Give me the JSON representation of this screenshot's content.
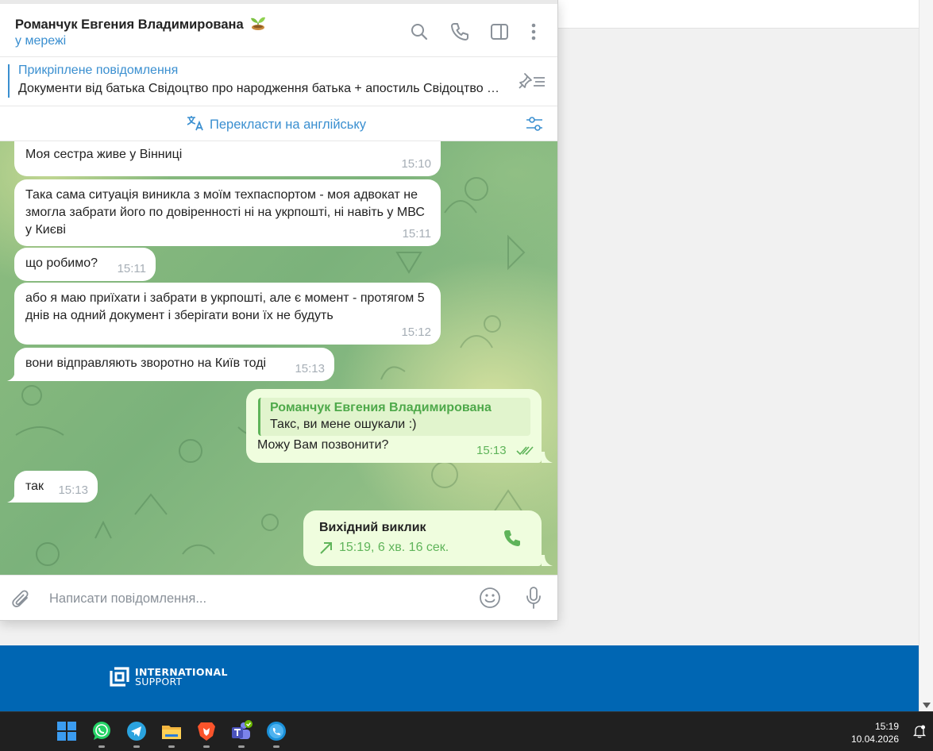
{
  "chat": {
    "title": "Романчук Евгения Владимирована",
    "status": "у мережі"
  },
  "pinned": {
    "title": "Прикріплене повідомлення",
    "text": "Документи від батька   Свідоцтво про народження батька + апостиль Свідоцтво про народження"
  },
  "translate": {
    "label": "Перекласти на англійську"
  },
  "messages": [
    {
      "text": "Моя сестра живе у Вінниці",
      "time": "15:10",
      "direction": "in"
    },
    {
      "text": "Така сама ситуація виникла з моїм техпаспортом - моя адвокат не змогла забрати його по довіренності ні на укрпошті, ні навіть у МВС у Києві",
      "time": "15:11",
      "direction": "in"
    },
    {
      "text": "що робимо?",
      "time": "15:11",
      "direction": "in"
    },
    {
      "text": "або я маю приїхати і забрати в укрпошті, але є момент - протягом 5 днів на одний документ і зберігати вони їх не будуть",
      "time": "15:12",
      "direction": "in"
    },
    {
      "text": "вони відправляють зворотно на Київ тоді",
      "time": "15:13",
      "direction": "in"
    },
    {
      "reply_name": "Романчук Евгения Владимирована",
      "reply_text": "Такс, ви мене ошукали :)",
      "text": "Можу Вам позвонити?",
      "time": "15:13",
      "direction": "out"
    },
    {
      "text": "так",
      "time": "15:13",
      "direction": "in"
    }
  ],
  "call": {
    "title": "Вихідний виклик",
    "info": "15:19, 6 хв. 16 сек."
  },
  "composer": {
    "placeholder": "Написати повідомлення..."
  },
  "banner": {
    "line1": "INTERNATIONAL",
    "line2": "SUPPORT"
  },
  "taskbar": {
    "time": "15:19",
    "date": "10.04.2026",
    "apps": [
      "windows-start",
      "whatsapp",
      "telegram",
      "file-explorer",
      "brave-browser",
      "teams",
      "skype"
    ]
  },
  "colors": {
    "accent": "#3a8fd0",
    "outgoing_bubble": "#effdde",
    "outgoing_accent": "#5fb45a",
    "banner": "#0066b3"
  }
}
